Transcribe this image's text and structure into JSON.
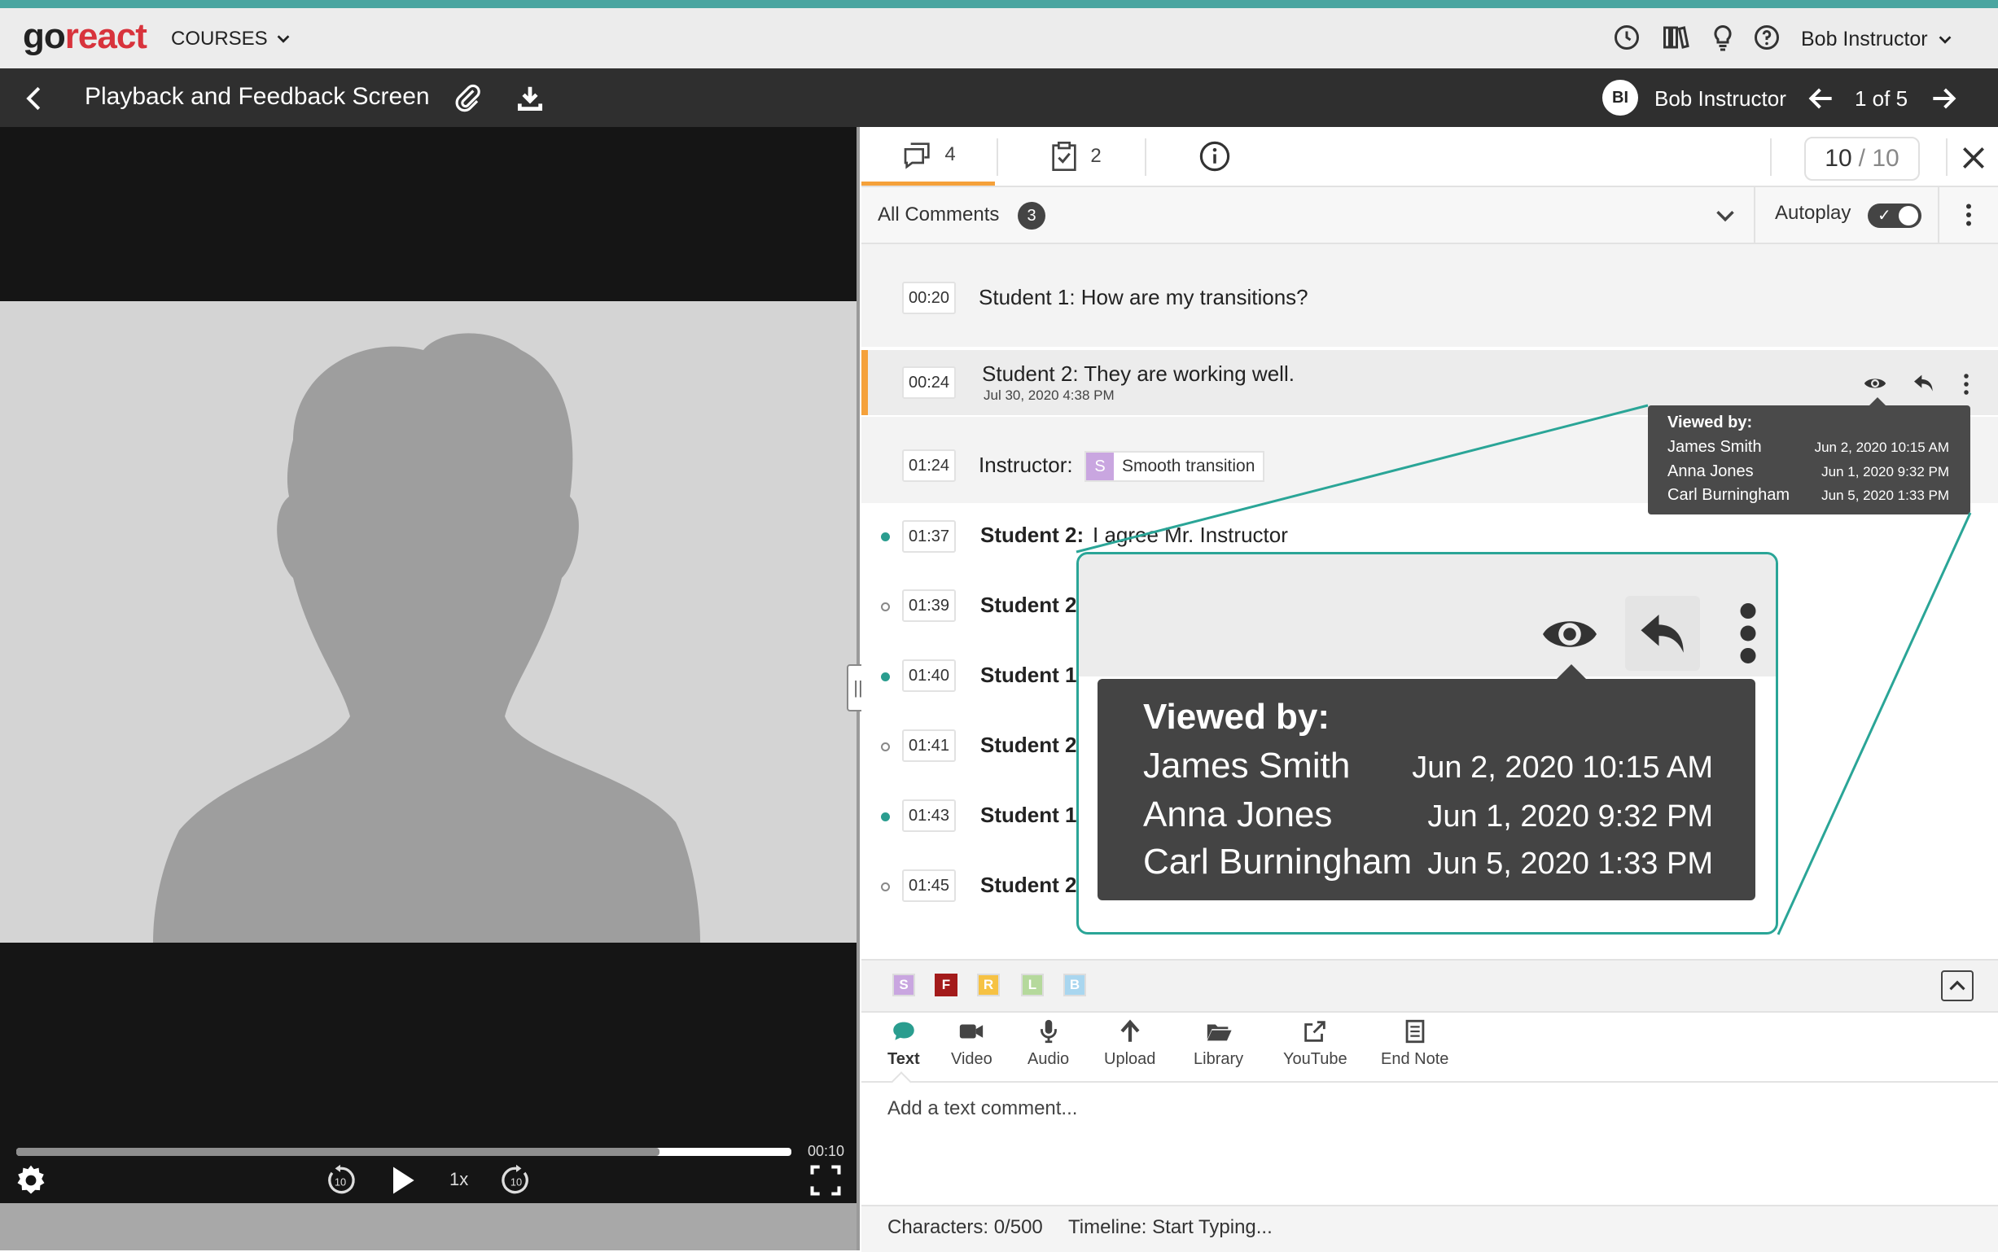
{
  "header": {
    "logo_go": "go",
    "logo_react": "react",
    "courses_label": "COURSES",
    "user_name": "Bob Instructor",
    "icons": [
      "clock-icon",
      "library-icon",
      "lightbulb-icon",
      "help-icon"
    ]
  },
  "titlebar": {
    "title": "Playback and Feedback Screen",
    "avatar_initials": "BI",
    "user_name": "Bob Instructor",
    "pager": "1 of 5"
  },
  "player": {
    "current_time": "00:10",
    "progress": 0.83,
    "speed": "1x",
    "skip_back_label": "10",
    "skip_forward_label": "10"
  },
  "tabs": {
    "comments_count": "4",
    "tasks_count": "2",
    "score_value": "10",
    "score_total": "/ 10"
  },
  "filter": {
    "label": "All Comments",
    "count": "3",
    "autoplay_label": "Autoplay"
  },
  "comments": [
    {
      "time": "00:20",
      "text": "Student 1: How are my transitions?"
    },
    {
      "time": "00:24",
      "text": "Student 2: They are working well.",
      "date": "Jul 30, 2020 4:38 PM"
    },
    {
      "time": "01:24",
      "author": "Instructor:",
      "tag_letter": "S",
      "tag_text": "Smooth transition"
    },
    {
      "time": "01:37",
      "author": "Student 2:",
      "text": "I agree Mr. Instructor"
    },
    {
      "time": "01:39",
      "author": "Student 2"
    },
    {
      "time": "01:40",
      "author": "Student 1"
    },
    {
      "time": "01:41",
      "author": "Student 2"
    },
    {
      "time": "01:43",
      "author": "Student 1"
    },
    {
      "time": "01:45",
      "author": "Student 2"
    }
  ],
  "viewed_by": {
    "title": "Viewed by:",
    "entries": [
      {
        "name": "James Smith",
        "date": "Jun 2, 2020 10:15 AM"
      },
      {
        "name": "Anna Jones",
        "date": "Jun 1, 2020 9:32 PM"
      },
      {
        "name": "Carl Burningham",
        "date": "Jun 5, 2020 1:33 PM"
      }
    ]
  },
  "markers": [
    {
      "letter": "S",
      "color": "#c9a6e0"
    },
    {
      "letter": "F",
      "color": "#a31b1b"
    },
    {
      "letter": "R",
      "color": "#f6c244"
    },
    {
      "letter": "L",
      "color": "#b5d99c"
    },
    {
      "letter": "B",
      "color": "#a9d6ef"
    }
  ],
  "tools": {
    "text": "Text",
    "video": "Video",
    "audio": "Audio",
    "upload": "Upload",
    "library": "Library",
    "youtube": "YouTube",
    "end_note": "End Note"
  },
  "composer": {
    "placeholder": "Add a text comment...",
    "characters": "Characters: 0/500",
    "timeline": "Timeline: Start Typing..."
  },
  "colors": {
    "accent_teal": "#4aa5a0",
    "brand_red": "#d8333c",
    "active_orange": "#f5a13a",
    "unread_dot": "#2a9d8f"
  }
}
